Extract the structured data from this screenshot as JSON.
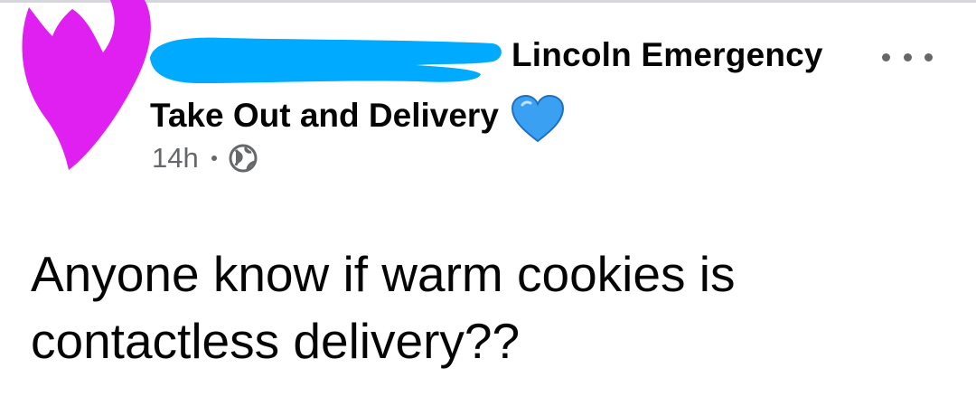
{
  "post": {
    "group_name_line1": "Lincoln Emergency",
    "group_name_line2": "Take Out and Delivery",
    "heart_emoji": "blue-heart-icon",
    "timestamp": "14h",
    "visibility_icon": "globe-icon",
    "options_icon": "more-options-icon",
    "body_line1": "Anyone know if warm cookies is",
    "body_line2": "contactless delivery??"
  },
  "redactions": {
    "avatar_color": "#e020f0",
    "name_color": "#00aaff"
  },
  "colors": {
    "text": "#050505",
    "secondary_text": "#65676b",
    "heart_blue": "#3aa0f2"
  }
}
